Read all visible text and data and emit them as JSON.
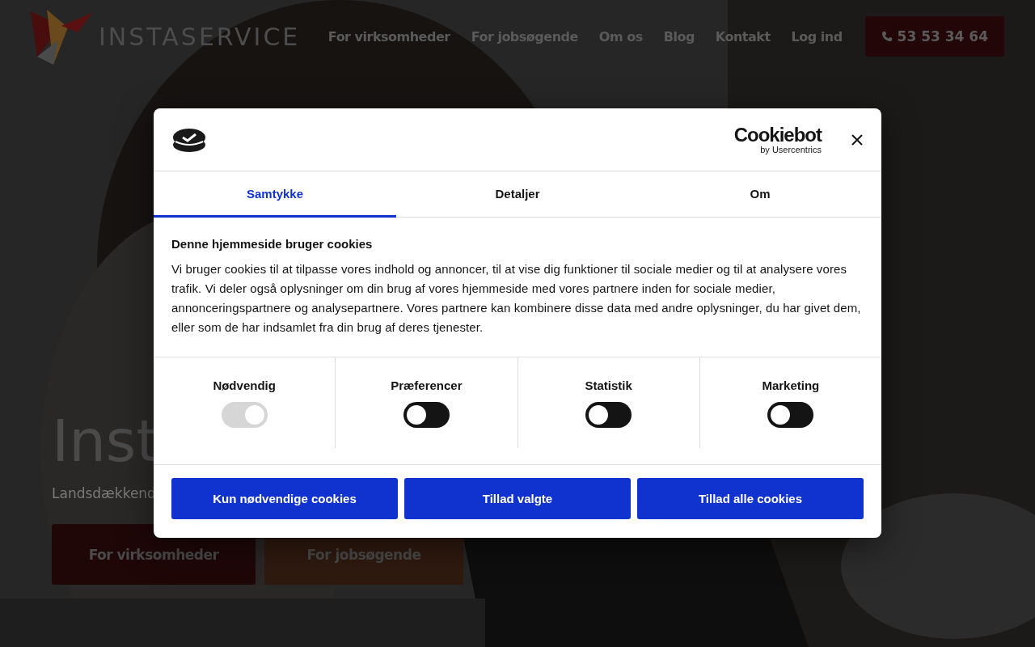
{
  "header": {
    "logo_text": "INSTASERVICE",
    "nav": [
      "For virksomheder",
      "For jobsøgende",
      "Om os",
      "Blog",
      "Kontakt",
      "Log ind"
    ],
    "phone": "53 53 34 64"
  },
  "hero": {
    "title": "Inst",
    "subtitle": "Landsdækkend",
    "buttons": [
      {
        "label": "For virksomheder",
        "kind": "primary"
      },
      {
        "label": "For jobsøgende",
        "kind": "secondary"
      }
    ]
  },
  "dialog": {
    "brand": "Cookiebot",
    "brand_sub": "by Usercentrics",
    "tabs": [
      {
        "label": "Samtykke",
        "selected": true
      },
      {
        "label": "Detaljer",
        "selected": false
      },
      {
        "label": "Om",
        "selected": false
      }
    ],
    "heading": "Denne hjemmeside bruger cookies",
    "body": "Vi bruger cookies til at tilpasse vores indhold og annoncer, til at vise dig funktioner til sociale medier og til at analysere vores trafik. Vi deler også oplysninger om din brug af vores hjemmeside med vores partnere inden for sociale medier, annonceringspartnere og analysepartnere. Vores partnere kan kombinere disse data med andre oplysninger, du har givet dem, eller som de har indsamlet fra din brug af deres tjenester.",
    "categories": [
      {
        "label": "Nødvendig",
        "checked": true,
        "disabled": true
      },
      {
        "label": "Præferencer",
        "checked": false,
        "disabled": false
      },
      {
        "label": "Statistik",
        "checked": false,
        "disabled": false
      },
      {
        "label": "Marketing",
        "checked": false,
        "disabled": false
      }
    ],
    "buttons": [
      "Kun nødvendige cookies",
      "Tillad valgte",
      "Tillad alle cookies"
    ]
  }
}
